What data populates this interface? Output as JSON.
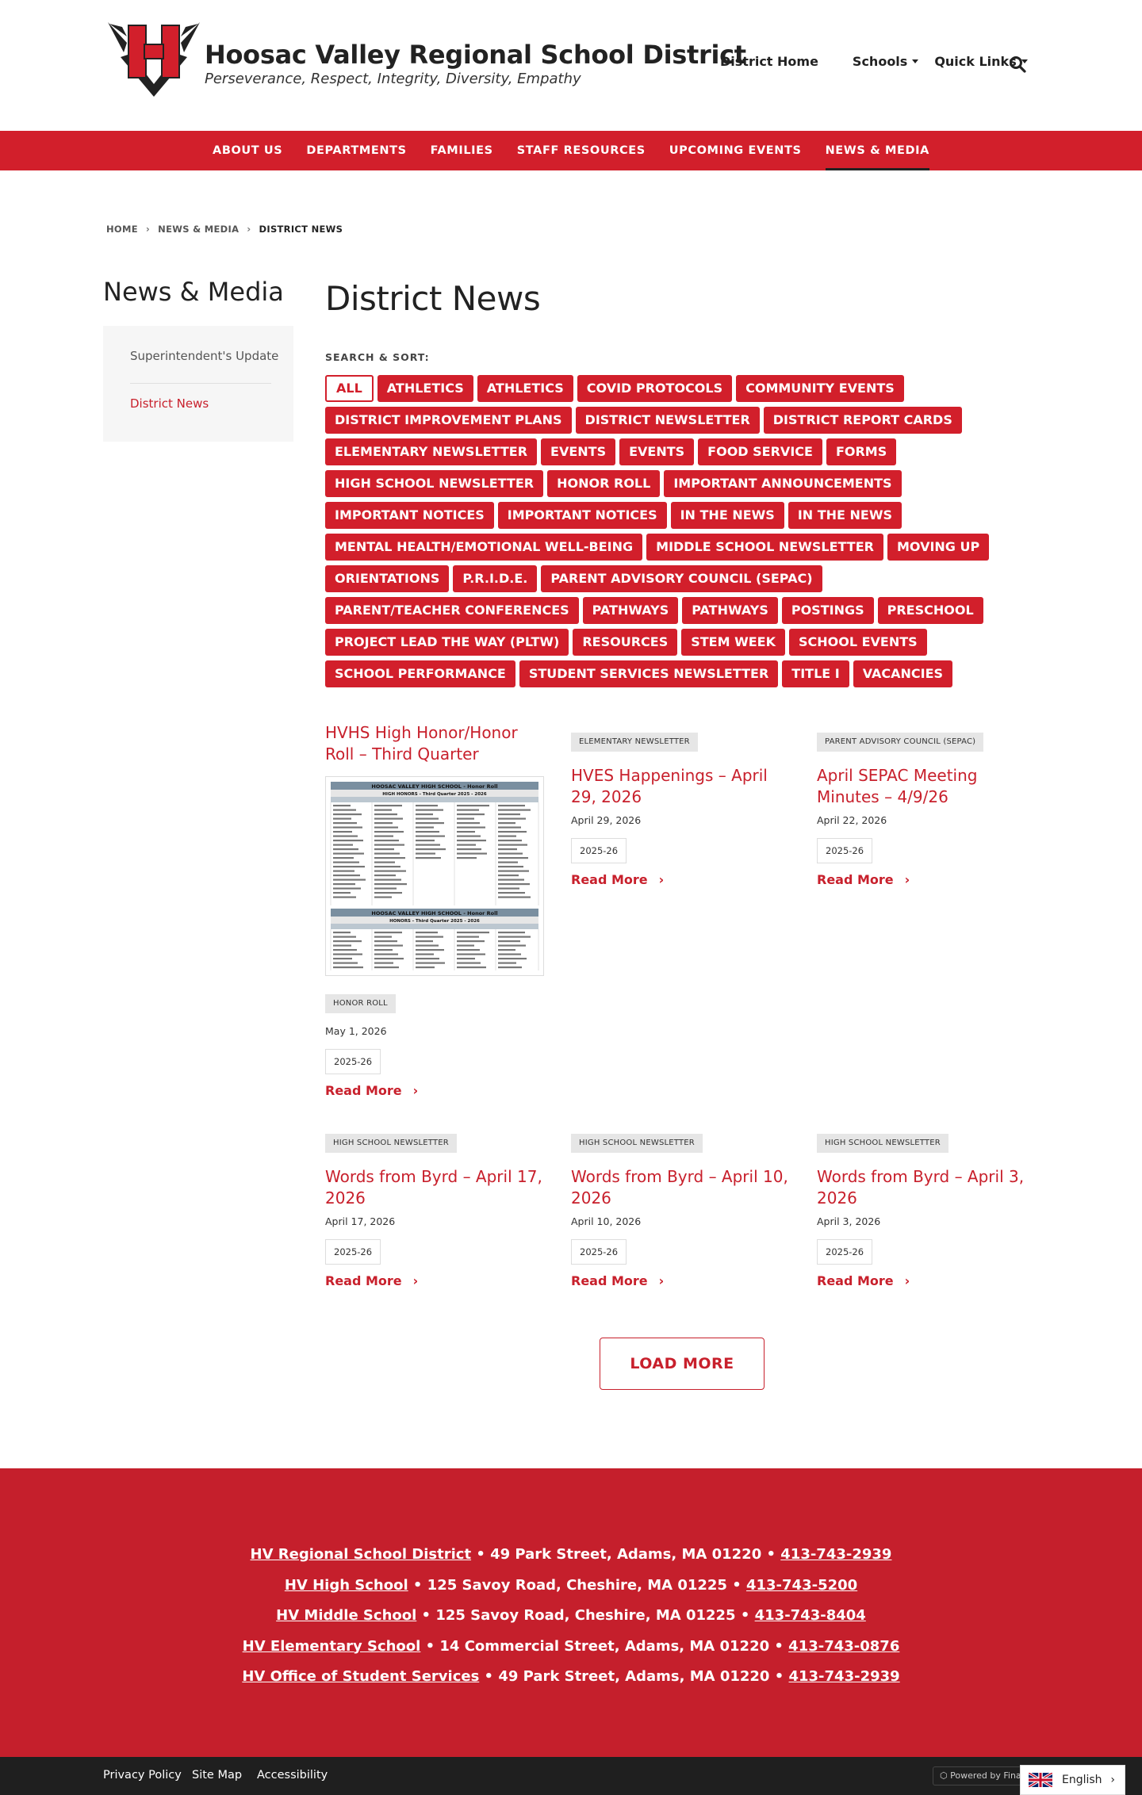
{
  "header": {
    "site_name": "Hoosac Valley Regional School District",
    "tagline": "Perseverance, Respect, Integrity, Diversity, Empathy",
    "utility_nav": [
      "District Home",
      "Schools",
      "Quick Links"
    ],
    "logo_letter": "H"
  },
  "main_nav": [
    "ABOUT US",
    "DEPARTMENTS",
    "FAMILIES",
    "STAFF RESOURCES",
    "UPCOMING EVENTS",
    "NEWS & MEDIA"
  ],
  "breadcrumb": [
    "HOME",
    "NEWS & MEDIA",
    "DISTRICT NEWS"
  ],
  "sidebar": {
    "title": "News & Media",
    "links": [
      "Superintendent's Update",
      "District News"
    ]
  },
  "content": {
    "title": "District News",
    "sort_label": "SEARCH & SORT:",
    "filters": [
      "ALL",
      "ATHLETICS",
      "ATHLETICS",
      "COVID PROTOCOLS",
      "COMMUNITY EVENTS",
      "DISTRICT IMPROVEMENT PLANS",
      "DISTRICT NEWSLETTER",
      "DISTRICT REPORT CARDS",
      "ELEMENTARY NEWSLETTER",
      "EVENTS",
      "EVENTS",
      "FOOD SERVICE",
      "FORMS",
      "HIGH SCHOOL NEWSLETTER",
      "HONOR ROLL",
      "IMPORTANT ANNOUNCEMENTS",
      "IMPORTANT NOTICES",
      "IMPORTANT NOTICES",
      "IN THE NEWS",
      "IN THE NEWS",
      "MENTAL HEALTH/EMOTIONAL WELL-BEING",
      "MIDDLE SCHOOL NEWSLETTER",
      "MOVING UP",
      "ORIENTATIONS",
      "P.R.I.D.E.",
      "PARENT ADVISORY COUNCIL (SEPAC)",
      "PARENT/TEACHER CONFERENCES",
      "PATHWAYS",
      "PATHWAYS",
      "POSTINGS",
      "PRESCHOOL",
      "PROJECT LEAD THE WAY (PLTW)",
      "RESOURCES",
      "STEM WEEK",
      "SCHOOL EVENTS",
      "SCHOOL PERFORMANCE",
      "STUDENT SERVICES NEWSLETTER",
      "TITLE I",
      "VACANCIES"
    ],
    "read_more": "Read More",
    "load_more": "LOAD MORE",
    "thumb": {
      "heading_1": "HOOSAC VALLEY HIGH SCHOOL - Honor Roll",
      "sub_1": "HIGH HONORS - Third Quarter 2025 - 2026",
      "heading_2": "HOOSAC VALLEY HIGH SCHOOL - Honor Roll",
      "sub_2": "HONORS - Third Quarter 2025 - 2026"
    },
    "articles": [
      {
        "title": "HVHS High Honor/Honor Roll – Third Quarter",
        "category": "HONOR ROLL",
        "date": "May 1, 2026",
        "year": "2025-26"
      },
      {
        "title": "HVES Happenings – April 29, 2026",
        "category": "ELEMENTARY NEWSLETTER",
        "date": "April 29, 2026",
        "year": "2025-26"
      },
      {
        "title": "April SEPAC Meeting Minutes – 4/9/26",
        "category": "PARENT ADVISORY COUNCIL (SEPAC)",
        "date": "April 22, 2026",
        "year": "2025-26"
      },
      {
        "title": "Words from Byrd – April 17, 2026",
        "category": "HIGH SCHOOL NEWSLETTER",
        "date": "April 17, 2026",
        "year": "2025-26"
      },
      {
        "title": "Words from Byrd – April 10, 2026",
        "category": "HIGH SCHOOL NEWSLETTER",
        "date": "April 10, 2026",
        "year": "2025-26"
      },
      {
        "title": "Words from Byrd – April 3, 2026",
        "category": "HIGH SCHOOL NEWSLETTER",
        "date": "April 3, 2026",
        "year": "2025-26"
      }
    ]
  },
  "footer": {
    "locations": [
      {
        "name": "HV Regional School District",
        "address": " • 49 Park Street, Adams, MA 01220 • ",
        "phone": "413-743-2939"
      },
      {
        "name": "HV High School",
        "address": " • 125 Savoy Road, Cheshire, MA 01225 • ",
        "phone": "413-743-5200"
      },
      {
        "name": "HV Middle School",
        "address": " • 125 Savoy Road, Cheshire, MA 01225 • ",
        "phone": "413-743-8404"
      },
      {
        "name": "HV Elementary School",
        "address": " • 14 Commercial Street, Adams, MA 01220 • ",
        "phone": "413-743-0876"
      },
      {
        "name": "HV Office of Student Services",
        "address": " • 49 Park Street, Adams, MA 01220 • ",
        "phone": "413-743-2939"
      }
    ],
    "bottom_links": [
      "Privacy Policy",
      "Site Map",
      "Accessibility"
    ],
    "powered_by": "Powered by Final",
    "language": "English"
  },
  "colors": {
    "brand_red": "#d21f2b",
    "footer_red": "#c51f2c",
    "link_red": "#c8202c"
  }
}
